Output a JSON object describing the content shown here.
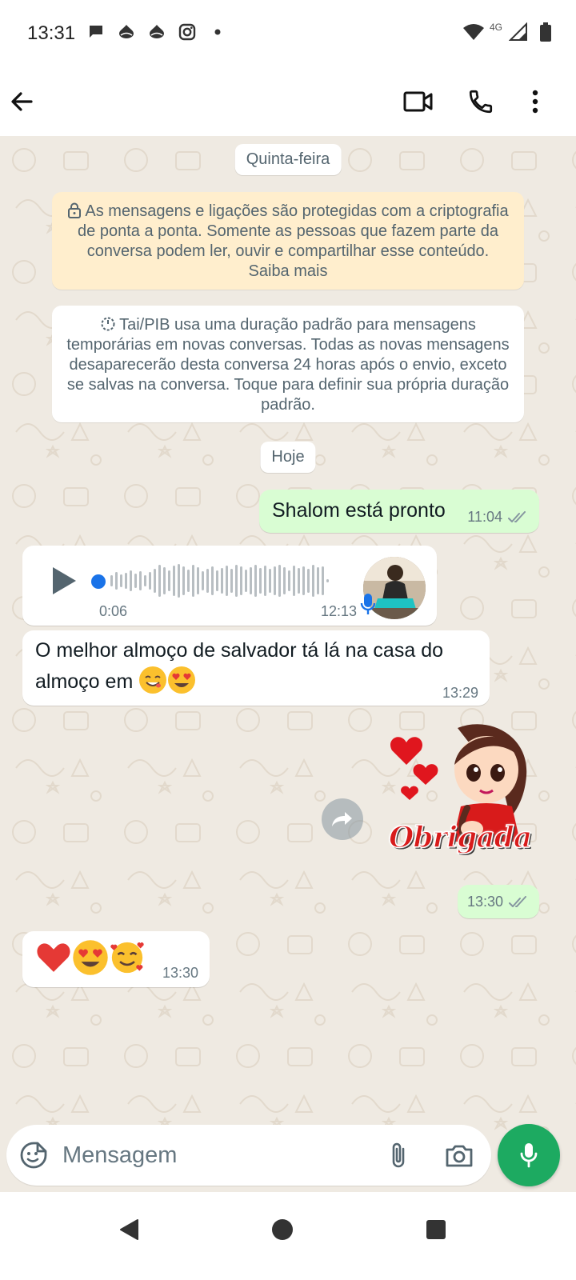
{
  "status_bar": {
    "time": "13:31",
    "network": "4G",
    "left_icons": [
      "chat-bubble-icon",
      "bank-icon",
      "bank-icon",
      "instagram-icon",
      "dot-icon"
    ],
    "right_icons": [
      "wifi-icon",
      "signal-icon",
      "battery-icon"
    ]
  },
  "app_bar": {
    "icons": [
      "back-arrow-icon",
      "video-camera-icon",
      "phone-icon",
      "more-vert-icon"
    ]
  },
  "chat": {
    "date_first": "Quinta-feira",
    "encryption_notice": "As mensagens e ligações são protegidas com a criptografia de ponta a ponta. Somente as pessoas que fazem parte da conversa podem ler, ouvir e compartilhar esse conteúdo. Saiba mais",
    "disappearing_notice": "Tai/PIB usa uma duração padrão para mensagens temporárias em novas conversas. Todas as novas mensagens desaparecerão desta conversa 24 horas após o envio, exceto se salvas na conversa. Toque para definir sua própria duração padrão.",
    "date_second": "Hoje",
    "messages": [
      {
        "direction": "out",
        "type": "text",
        "text": "Shalom está pronto",
        "time": "11:04",
        "status": "read"
      },
      {
        "direction": "in",
        "type": "voice",
        "duration": "0:06",
        "time": "12:13"
      },
      {
        "direction": "in",
        "type": "text",
        "text": "O melhor almoço de salvador tá lá na casa do almoço em",
        "emojis": [
          "smiling-face-icon",
          "heart-eyes-icon"
        ],
        "time": "13:29"
      },
      {
        "direction": "out",
        "type": "sticker",
        "sticker_text": "Obrigada",
        "time": "13:30",
        "status": "read"
      },
      {
        "direction": "in",
        "type": "emoji",
        "emojis": [
          "red-heart-icon",
          "heart-eyes-icon",
          "smiling-hearts-icon"
        ],
        "time": "13:30"
      }
    ]
  },
  "composer": {
    "placeholder": "Mensagem",
    "icons": [
      "sticker-icon",
      "attach-icon",
      "camera-icon",
      "mic-icon"
    ]
  },
  "nav_bar": {
    "icons": [
      "back-triangle-icon",
      "home-circle-icon",
      "recents-square-icon"
    ]
  },
  "colors": {
    "chat_background": "#efeae2",
    "outgoing_bubble": "#d9fdd3",
    "incoming_bubble": "#ffffff",
    "encryption_notice_bg": "#ffeecd",
    "fab_green": "#1daa61",
    "read_ticks": "#8696a0",
    "voice_progress": "#1a73e8"
  }
}
